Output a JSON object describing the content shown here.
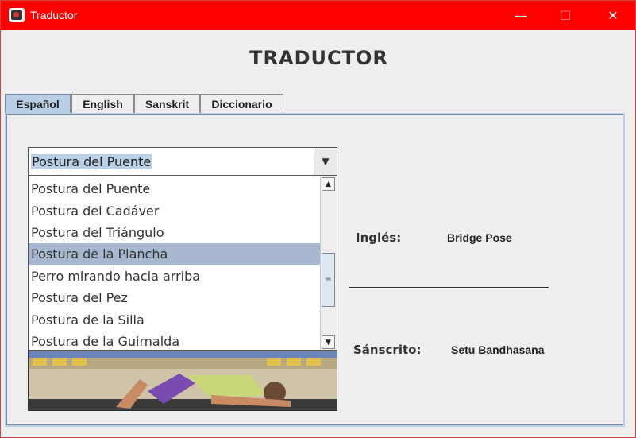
{
  "window": {
    "title": "Traductor",
    "controls": {
      "minimize": "—",
      "maximize": "☐",
      "close": "✕"
    },
    "title_bar_color": "#ff0000"
  },
  "heading": "TRADUCTOR",
  "tabs": [
    {
      "label": "Español",
      "active": true
    },
    {
      "label": "English",
      "active": false
    },
    {
      "label": "Sanskrit",
      "active": false
    },
    {
      "label": "Diccionario",
      "active": false
    }
  ],
  "combo": {
    "selected": "Postura del Puente",
    "arrow_icon": "▼"
  },
  "dropdown": {
    "items": [
      "Postura del Puente",
      "Postura del Cadáver",
      "Postura del Triángulo",
      "Postura de la Plancha",
      "Perro mirando hacia arriba",
      "Postura del Pez",
      "Postura de la Silla",
      "Postura de la Guirnalda"
    ],
    "highlighted_index": 3,
    "scroll_up_icon": "▲",
    "scroll_down_icon": "▼",
    "thumb_grip": "≡"
  },
  "translation": {
    "english_label": "Inglés:",
    "english_value": "Bridge Pose",
    "sanskrit_label": "Sánscrito:",
    "sanskrit_value": "Setu Bandhasana"
  },
  "image": {
    "depicts": "pose-image"
  },
  "colors": {
    "accent": "#b8cfe5",
    "selection": "#a6b7cf"
  }
}
